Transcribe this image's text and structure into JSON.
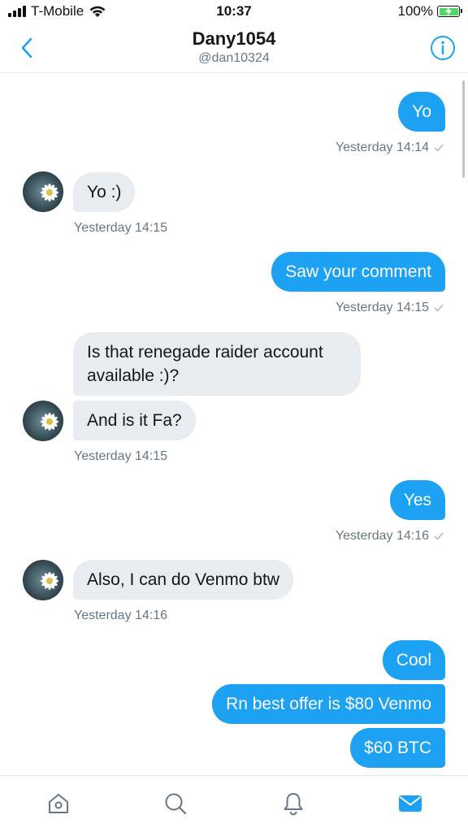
{
  "status_bar": {
    "carrier": "T-Mobile",
    "time": "10:37",
    "battery": "100%"
  },
  "header": {
    "title": "Dany1054",
    "handle": "@dan10324"
  },
  "colors": {
    "accent": "#1da1f2",
    "incoming_bubble": "#e6ecf0",
    "secondary_text": "#657786"
  },
  "messages": [
    {
      "direction": "out",
      "text": "Yo"
    },
    {
      "direction": "in",
      "text": "Yo :)"
    },
    {
      "direction": "out",
      "text": "Saw your comment"
    },
    {
      "direction": "in",
      "text": "Is that renegade raider account available :)?"
    },
    {
      "direction": "in",
      "text": "And is it Fa?"
    },
    {
      "direction": "out",
      "text": "Yes"
    },
    {
      "direction": "in",
      "text": "Also, I can do Venmo btw"
    },
    {
      "direction": "out",
      "text": "Cool"
    },
    {
      "direction": "out",
      "text": "Rn best offer is $80 Venmo"
    },
    {
      "direction": "out",
      "text": "$60 BTC"
    }
  ],
  "timestamps": [
    "Yesterday 14:14",
    "Yesterday 14:15",
    "Yesterday 14:15",
    "Yesterday 14:15",
    "Yesterday 14:16",
    "Yesterday 14:16"
  ],
  "tabbar": {
    "items": [
      "home-icon",
      "search-icon",
      "notifications-icon",
      "messages-icon"
    ],
    "active": "messages-icon"
  }
}
